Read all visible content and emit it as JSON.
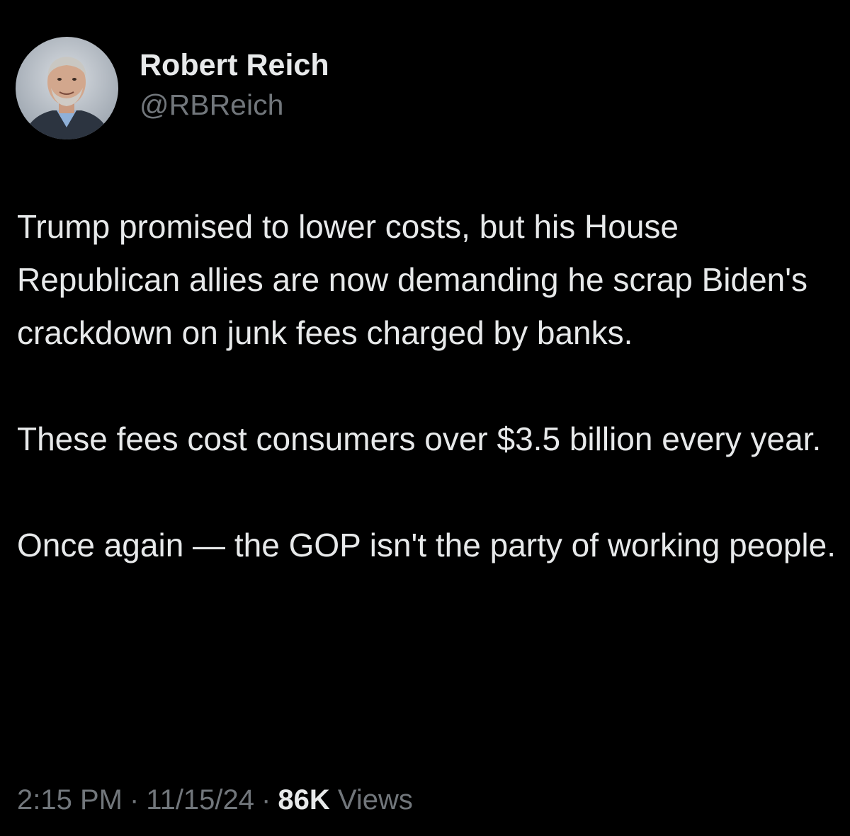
{
  "tweet": {
    "author": {
      "display_name": "Robert Reich",
      "handle": "@RBReich",
      "avatar_icon": "profile-photo"
    },
    "paragraphs": [
      "Trump promised to lower costs, but his House Republican allies are now demanding he scrap Biden's crackdown on junk fees charged by banks.",
      "These fees cost consumers over $3.5 billion every year.",
      "Once again — the GOP isn't the party of working people."
    ],
    "meta": {
      "time": "2:15 PM",
      "date": "11/15/24",
      "separator": "·",
      "views_count": "86K",
      "views_label": "Views"
    }
  },
  "colors": {
    "background": "#000000",
    "primary_text": "#e7e9ea",
    "secondary_text": "#71767b"
  }
}
